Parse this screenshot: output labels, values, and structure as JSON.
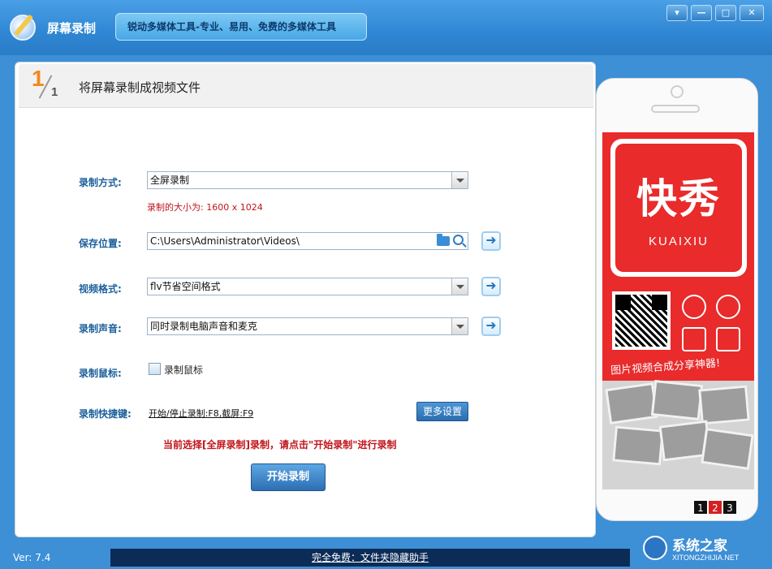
{
  "window": {
    "title": "屏幕录制",
    "slogan": "锐动多媒体工具-专业、易用、免费的多媒体工具",
    "controls": {
      "menu": "▾",
      "minimize": "—",
      "maximize": "□",
      "close": "✕"
    }
  },
  "step": {
    "current": "1",
    "total": "1",
    "title": "将屏幕录制成视频文件"
  },
  "form": {
    "record_mode": {
      "label": "录制方式:",
      "value": "全屏录制"
    },
    "size_note": "录制的大小为: 1600 x 1024",
    "save_location": {
      "label": "保存位置:",
      "value": "C:\\Users\\Administrator\\Videos\\"
    },
    "video_format": {
      "label": "视频格式:",
      "value": "flv节省空间格式"
    },
    "audio": {
      "label": "录制声音:",
      "value": "同时录制电脑声音和麦克"
    },
    "mouse": {
      "label": "录制鼠标:",
      "checkbox_label": "录制鼠标",
      "checked": false
    },
    "hotkey": {
      "label": "录制快捷键:",
      "value": "开始/停止录制:F8,截屏:F9",
      "more_button": "更多设置"
    },
    "status_message": "当前选择[全屏录制]录制，请点击\"开始录制\"进行录制",
    "start_button": "开始录制"
  },
  "ad": {
    "brand_cn": "快秀",
    "brand_en": "KUAIXIU",
    "slogan": "图片视频合成分享神器!",
    "pages": [
      "1",
      "2",
      "3"
    ],
    "active_page": "2"
  },
  "footer": {
    "version": "Ver: 7.4",
    "link": "完全免费：文件夹隐藏助手",
    "watermark_cn": "系统之家",
    "watermark_en": "XITONGZHIJIA.NET"
  },
  "colors": {
    "titlebar": "#2f86d3",
    "label": "#1b5f9c",
    "alert": "#c0141a",
    "ad_red": "#e92b2b"
  }
}
